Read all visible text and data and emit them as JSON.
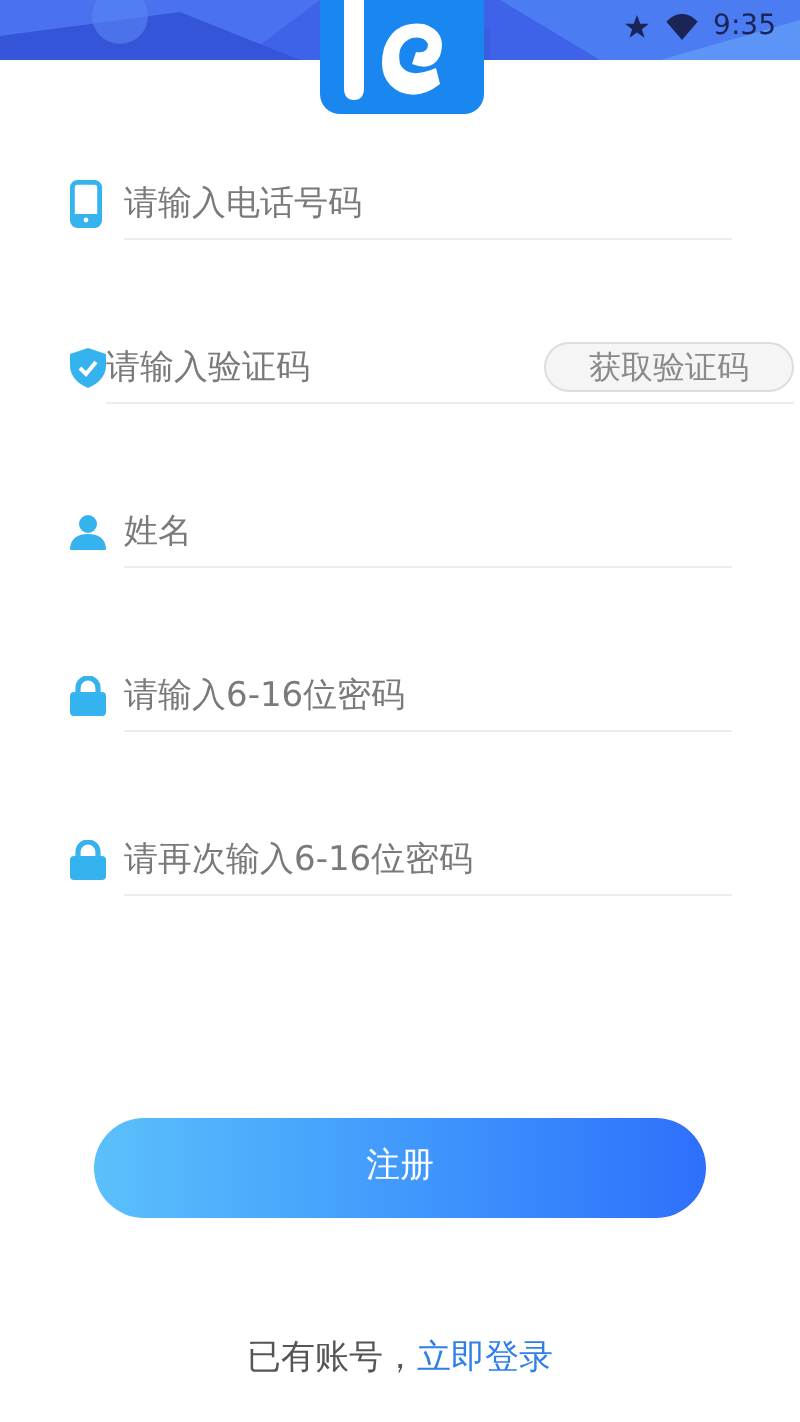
{
  "status_bar": {
    "time": "9:35"
  },
  "fields": [
    {
      "kind": "phone",
      "placeholder": "请输入电话号码"
    },
    {
      "kind": "code",
      "placeholder": "请输入验证码",
      "button": "获取验证码"
    },
    {
      "kind": "user",
      "placeholder": "姓名"
    },
    {
      "kind": "lock",
      "placeholder": "请输入6-16位密码"
    },
    {
      "kind": "lock",
      "placeholder": "请再次输入6-16位密码"
    }
  ],
  "submit": "注册",
  "footer": {
    "text": "已有账号，",
    "link": "立即登录"
  }
}
